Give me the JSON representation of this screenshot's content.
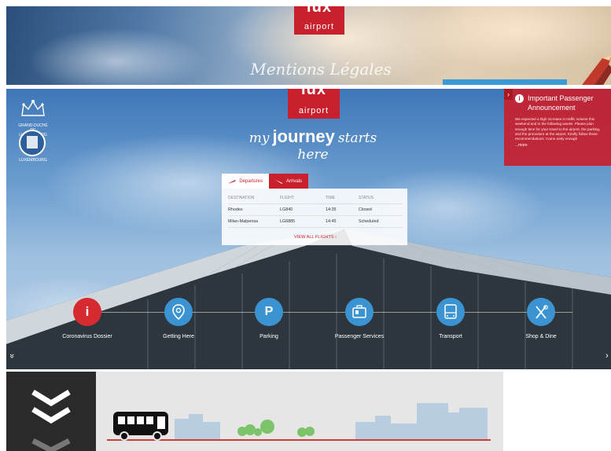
{
  "top_strip": {
    "logo_mark": "lux",
    "logo_text": "airport",
    "mentions_label": "Mentions Légales"
  },
  "hero": {
    "logo_mark": "lux",
    "logo_text": "airport",
    "crest_label": "GRAND-DUCHÉ DE LUXEMBOURG",
    "seal_label": "LUXEMBOURG",
    "tagline": {
      "my": "my",
      "journey": "journey",
      "starts": "starts here"
    }
  },
  "announcement": {
    "arrow": "›",
    "title": "Important Passenger Announcement",
    "body": "We expected a high increase in traffic volume this weekend and in the following weeks. Please plan enough time for your travel to the airport, the parking, and the procedure at the airport. Kindly follow these recommendations: Come early enough",
    "more": "...more"
  },
  "flights": {
    "tab_departures": "Departures",
    "tab_arrivals": "Arrivals",
    "headers": [
      "DESTINATION",
      "FLIGHT",
      "TIME",
      "STATUS"
    ],
    "rows": [
      [
        "Rhodes",
        "LG840",
        "14:35",
        "Closed"
      ],
      [
        "Milan-Malpensa",
        "LG6885",
        "14:45",
        "Scheduled"
      ]
    ],
    "view_all": "VIEW ALL FLIGHTS ›"
  },
  "services": [
    {
      "label": "Coronavirus Dossier",
      "icon": "info-icon",
      "glyph": "i"
    },
    {
      "label": "Getting Here",
      "icon": "map-pin-icon",
      "glyph": ""
    },
    {
      "label": "Parking",
      "icon": "parking-icon",
      "glyph": "P"
    },
    {
      "label": "Passenger Services",
      "icon": "suitcase-icon",
      "glyph": ""
    },
    {
      "label": "Transport",
      "icon": "bus-icon",
      "glyph": ""
    },
    {
      "label": "Shop & Dine",
      "icon": "utensils-icon",
      "glyph": ""
    }
  ],
  "nav": {
    "chevron_left": "»",
    "chevron_right": "›"
  },
  "colors": {
    "brand_red": "#c8202d",
    "service_blue": "#3b93d2",
    "service_red": "#d72a30",
    "accent_blue": "#3a9ad9"
  }
}
